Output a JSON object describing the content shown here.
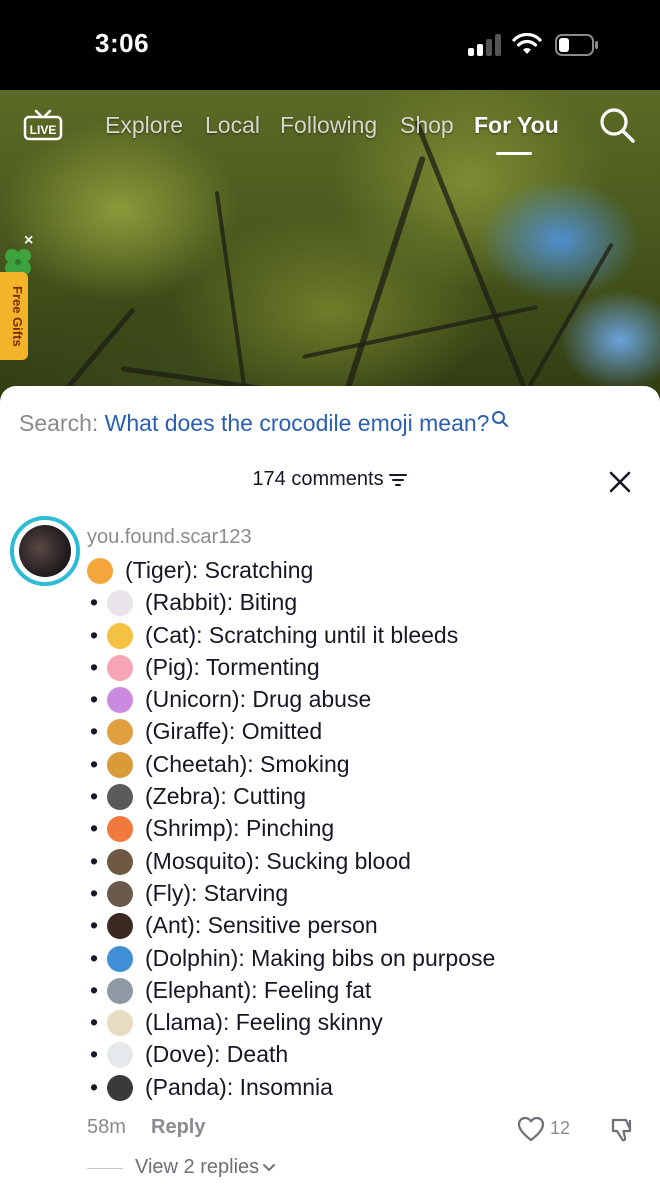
{
  "status": {
    "time": "3:06"
  },
  "nav": {
    "live_label": "LIVE",
    "tabs": [
      {
        "label": "Explore",
        "active": false
      },
      {
        "label": "Local",
        "active": false
      },
      {
        "label": "Following",
        "active": false
      },
      {
        "label": "Shop",
        "active": false
      },
      {
        "label": "For You",
        "active": true
      }
    ]
  },
  "gifts": {
    "label": "Free Gifts",
    "close": "×"
  },
  "search": {
    "prefix": "Search:",
    "query": "What does the crocodile emoji mean?"
  },
  "comments": {
    "count_label": "174 comments"
  },
  "comment": {
    "username": "you.found.scar123",
    "lines": [
      {
        "bullet": "",
        "emoji": "tiger-face",
        "text": "(Tiger): Scratching"
      },
      {
        "bullet": "•",
        "emoji": "rabbit-face",
        "text": "(Rabbit): Biting"
      },
      {
        "bullet": "•",
        "emoji": "cat-face",
        "text": "(Cat): Scratching until it bleeds"
      },
      {
        "bullet": "•",
        "emoji": "pig-face",
        "text": "(Pig): Tormenting"
      },
      {
        "bullet": "•",
        "emoji": "unicorn",
        "text": "(Unicorn): Drug abuse"
      },
      {
        "bullet": "•",
        "emoji": "giraffe",
        "text": "(Giraffe): Omitted"
      },
      {
        "bullet": "•",
        "emoji": "leopard",
        "text": "(Cheetah): Smoking"
      },
      {
        "bullet": "•",
        "emoji": "zebra",
        "text": "(Zebra): Cutting"
      },
      {
        "bullet": "•",
        "emoji": "shrimp",
        "text": "(Shrimp): Pinching"
      },
      {
        "bullet": "•",
        "emoji": "mosquito",
        "text": "(Mosquito): Sucking blood"
      },
      {
        "bullet": "•",
        "emoji": "fly",
        "text": "(Fly): Starving"
      },
      {
        "bullet": "•",
        "emoji": "ant",
        "text": "(Ant): Sensitive person"
      },
      {
        "bullet": "•",
        "emoji": "dolphin",
        "text": "(Dolphin): Making bibs on purpose"
      },
      {
        "bullet": "•",
        "emoji": "elephant",
        "text": "(Elephant): Feeling fat"
      },
      {
        "bullet": "•",
        "emoji": "llama",
        "text": "(Llama): Feeling skinny"
      },
      {
        "bullet": "•",
        "emoji": "dove",
        "text": "(Dove): Death"
      },
      {
        "bullet": "•",
        "emoji": "panda-face",
        "text": "(Panda): Insomnia"
      }
    ],
    "emoji_colors": {
      "tiger-face": "#f3a63b",
      "rabbit-face": "#e8e4ea",
      "cat-face": "#f5c142",
      "pig-face": "#f6a5b5",
      "unicorn": "#c98ae0",
      "giraffe": "#e0a040",
      "leopard": "#d99a3a",
      "zebra": "#5a5a5a",
      "shrimp": "#f07a3c",
      "mosquito": "#6e5a44",
      "fly": "#6a5a4a",
      "ant": "#3b2a22",
      "dolphin": "#3f8fd6",
      "elephant": "#8f9aa6",
      "llama": "#e8dcc0",
      "dove": "#e6e9ec",
      "panda-face": "#3a3a3a"
    },
    "time": "58m",
    "reply_label": "Reply",
    "likes": "12",
    "view_replies": "View 2 replies"
  },
  "colors": {
    "accent_ring": "#2dbcd6",
    "link_blue": "#2b5fb4"
  }
}
